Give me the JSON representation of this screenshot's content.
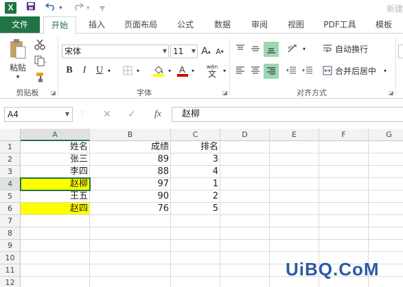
{
  "titlebar": {
    "app_icon": "X",
    "doc_title": "新建"
  },
  "tabs": [
    {
      "label": "文件"
    },
    {
      "label": "开始"
    },
    {
      "label": "插入"
    },
    {
      "label": "页面布局"
    },
    {
      "label": "公式"
    },
    {
      "label": "数据"
    },
    {
      "label": "审阅"
    },
    {
      "label": "视图"
    },
    {
      "label": "PDF工具"
    },
    {
      "label": "模板"
    }
  ],
  "ribbon": {
    "clipboard": {
      "paste_label": "粘贴",
      "group_label": "剪贴板"
    },
    "font": {
      "font_name": "宋体",
      "font_size": "11",
      "group_label": "字体",
      "wen_label": "wén",
      "wen_char": "文"
    },
    "alignment": {
      "wrap_label": "自动换行",
      "merge_label": "合并后居中",
      "group_label": "对齐方式"
    }
  },
  "formula_bar": {
    "name_box": "A4",
    "fx": "fx",
    "content": "赵柳"
  },
  "sheet": {
    "columns": [
      "A",
      "B",
      "C",
      "D",
      "E",
      "F",
      "G"
    ],
    "rows": [
      "1",
      "2",
      "3",
      "4",
      "5",
      "6",
      "7",
      "8",
      "9",
      "10",
      "11",
      "12"
    ],
    "data": [
      [
        "姓名",
        "成绩",
        "排名"
      ],
      [
        "张三",
        "89",
        "3"
      ],
      [
        "李四",
        "88",
        "4"
      ],
      [
        "赵柳",
        "97",
        "1"
      ],
      [
        "王五",
        "90",
        "2"
      ],
      [
        "赵四",
        "76",
        "5"
      ]
    ],
    "highlight_color": "#ffff00"
  },
  "watermark": "UiBQ.CoM",
  "colors": {
    "accent": "#217346"
  }
}
